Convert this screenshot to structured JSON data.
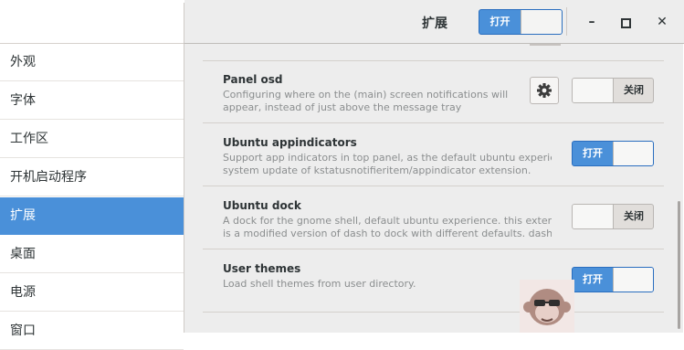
{
  "header": {
    "title": "扩展",
    "master_switch": {
      "state": "on",
      "label": "打开"
    }
  },
  "window_controls": {
    "minimize": "–",
    "maximize": "□",
    "close": "✕"
  },
  "sidebar": {
    "items": [
      {
        "label": "外观",
        "active": false
      },
      {
        "label": "字体",
        "active": false
      },
      {
        "label": "工作区",
        "active": false
      },
      {
        "label": "开机启动程序",
        "active": false
      },
      {
        "label": "扩展",
        "active": true
      },
      {
        "label": "桌面",
        "active": false
      },
      {
        "label": "电源",
        "active": false
      },
      {
        "label": "窗口",
        "active": false
      }
    ]
  },
  "extensions": [
    {
      "name": "Panel osd",
      "description_lines": [
        "Configuring where on the (main) screen notifications will",
        "appear, instead of just above the message tray"
      ],
      "has_settings": true,
      "settings_icon": "gear-icon",
      "enabled": false,
      "switch_label": "关闭"
    },
    {
      "name": "Ubuntu appindicators",
      "description_lines": [
        "Support app indicators in top panel, as the default ubuntu experience.",
        "system update of kstatusnotifieritem/appindicator extension."
      ],
      "has_settings": false,
      "enabled": true,
      "switch_label": "打开"
    },
    {
      "name": "Ubuntu dock",
      "description_lines": [
        "A dock for the gnome shell, default ubuntu experience. this extension",
        "is a modified version of dash to dock with different defaults. dash t…"
      ],
      "has_settings": false,
      "enabled": false,
      "switch_label": "关闭"
    },
    {
      "name": "User themes",
      "description_lines": [
        "Load shell themes from user directory."
      ],
      "has_settings": false,
      "enabled": true,
      "switch_label": "打开"
    }
  ],
  "colors": {
    "accent": "#4a90d9",
    "sidebar_bg": "#ffffff",
    "content_bg": "#ededed"
  }
}
